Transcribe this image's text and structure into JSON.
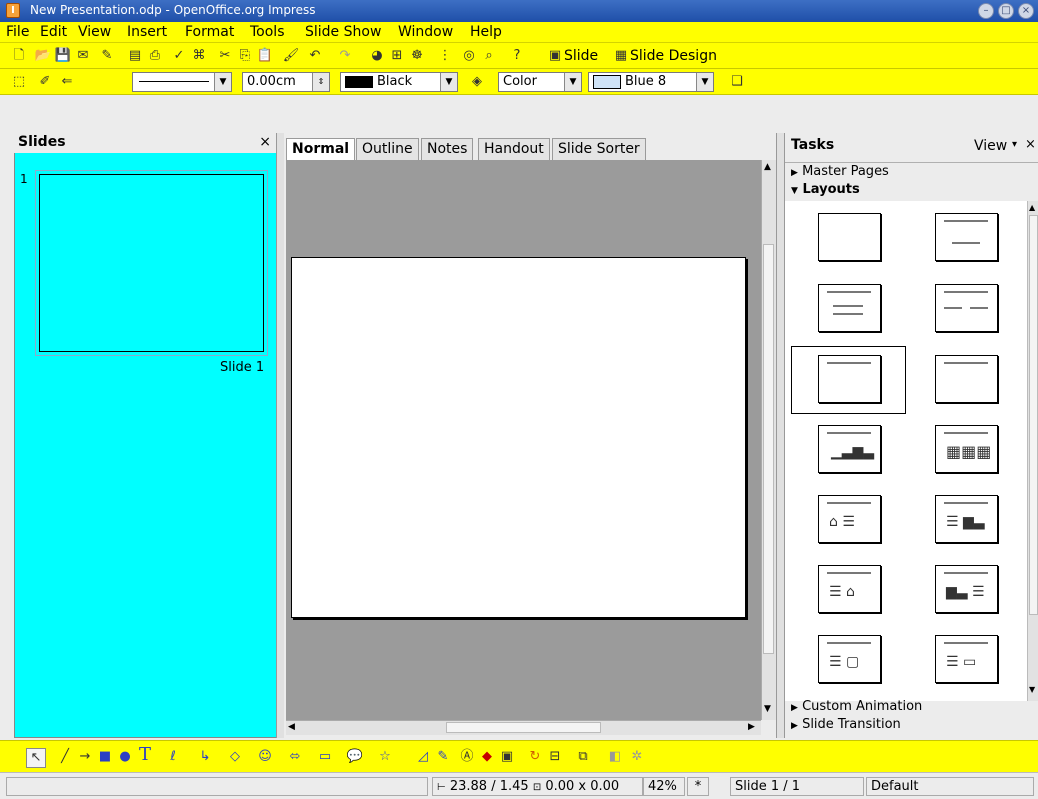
{
  "window": {
    "title": "New Presentation.odp - OpenOffice.org Impress"
  },
  "menu": [
    "File",
    "Edit",
    "View",
    "Insert",
    "Format",
    "Tools",
    "Slide Show",
    "Window",
    "Help"
  ],
  "toolbar1": {
    "slide_label": "Slide",
    "slide_design_label": "Slide Design"
  },
  "toolbar2": {
    "line_width": "0.00cm",
    "line_color": "Black",
    "area_style": "Color",
    "area_color": "Blue 8"
  },
  "slides_pane": {
    "title": "Slides",
    "close": "×",
    "slide_number": "1",
    "slide_name": "Slide 1"
  },
  "view_tabs": [
    "Normal",
    "Outline",
    "Notes",
    "Handout",
    "Slide Sorter"
  ],
  "tasks_pane": {
    "title": "Tasks",
    "view_label": "View",
    "close": "×",
    "sections": {
      "master_pages": "Master Pages",
      "layouts": "Layouts",
      "custom_animation": "Custom Animation",
      "slide_transition": "Slide Transition"
    }
  },
  "status_bar": {
    "position": "23.88 / 1.45",
    "size": "0.00 x 0.00",
    "zoom": "42%",
    "modified": "*",
    "slide": "Slide 1 / 1",
    "master": "Default"
  },
  "colors": {
    "toolbar_bg": "#ffff00",
    "slide_pane_bg": "#00ffff",
    "title_bar": "#2a5bb3",
    "canvas": "#9b9b9b"
  }
}
